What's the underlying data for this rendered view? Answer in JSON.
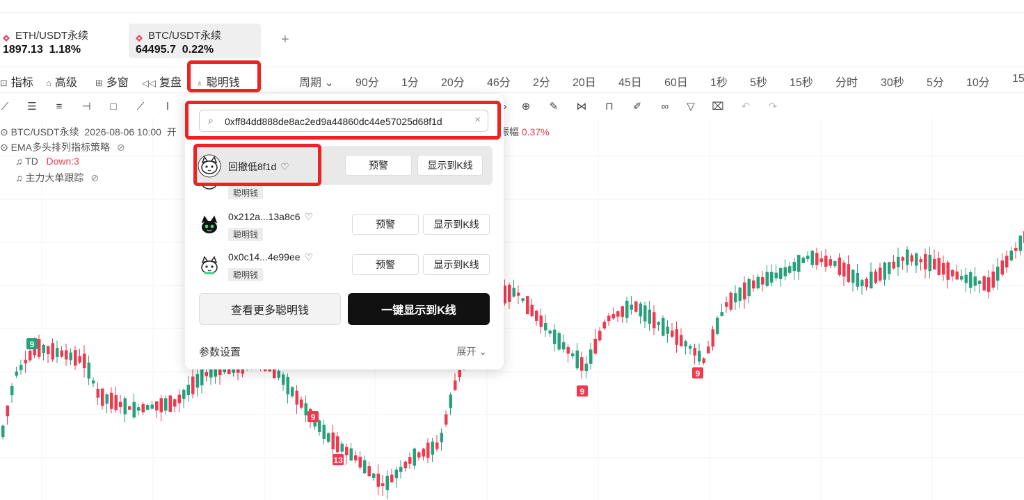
{
  "tabs": [
    {
      "symbol": "ETH/USDT永续",
      "price": "1897.13",
      "change": "1.18%",
      "active": false
    },
    {
      "symbol": "BTC/USDT永续",
      "price": "64495.7",
      "change": "0.22%",
      "active": true
    }
  ],
  "add_tab_label": "+",
  "toolbar": {
    "indicator": "指标",
    "advanced": "高级",
    "multi_window": "多窗",
    "replay": "复盘",
    "smart_money": "聪明钱",
    "period": "周期",
    "periods": [
      "90分",
      "1分",
      "20分",
      "46分",
      "2分",
      "20日",
      "45日",
      "60日",
      "1秒",
      "5秒",
      "15秒",
      "分时",
      "30秒",
      "5分",
      "10分",
      "15"
    ]
  },
  "legend": {
    "title": "BTC/USDT永续",
    "date": "2026-08-06 10:00",
    "title_suffix": "开",
    "change_label": "振幅",
    "change_value": "0.37%",
    "ema_strategy": "EMA多头排列指标策略",
    "td_label": "TD",
    "td_value": "Down:3",
    "whale_tracking": "主力大单跟踪"
  },
  "popup": {
    "search_value": "0xff84dd888de8ac2ed9a44860dc44e57025d68f1d",
    "clear_icon": "×",
    "rows": [
      {
        "name": "回撤低8f1d",
        "tag": "",
        "alert": "预警",
        "show": "显示到K线"
      },
      {
        "name": "",
        "tag": "聪明钱",
        "alert": "",
        "show": ""
      },
      {
        "name": "0x212a...13a8c6",
        "tag": "聪明钱",
        "alert": "预警",
        "show": "显示到K线"
      },
      {
        "name": "0x0c14...4e99ee",
        "tag": "聪明钱",
        "alert": "预警",
        "show": "显示到K线"
      }
    ],
    "more_button": "查看更多聪明钱",
    "show_all_button": "一键显示到K线",
    "params_label": "参数设置",
    "expand_label": "展开"
  },
  "chart_markers": [
    "9",
    "9",
    "13",
    "9",
    "9"
  ],
  "colors": {
    "up": "#26a17b",
    "down": "#f0394f",
    "highlight": "#ee2222",
    "primary_button": "#111111"
  }
}
